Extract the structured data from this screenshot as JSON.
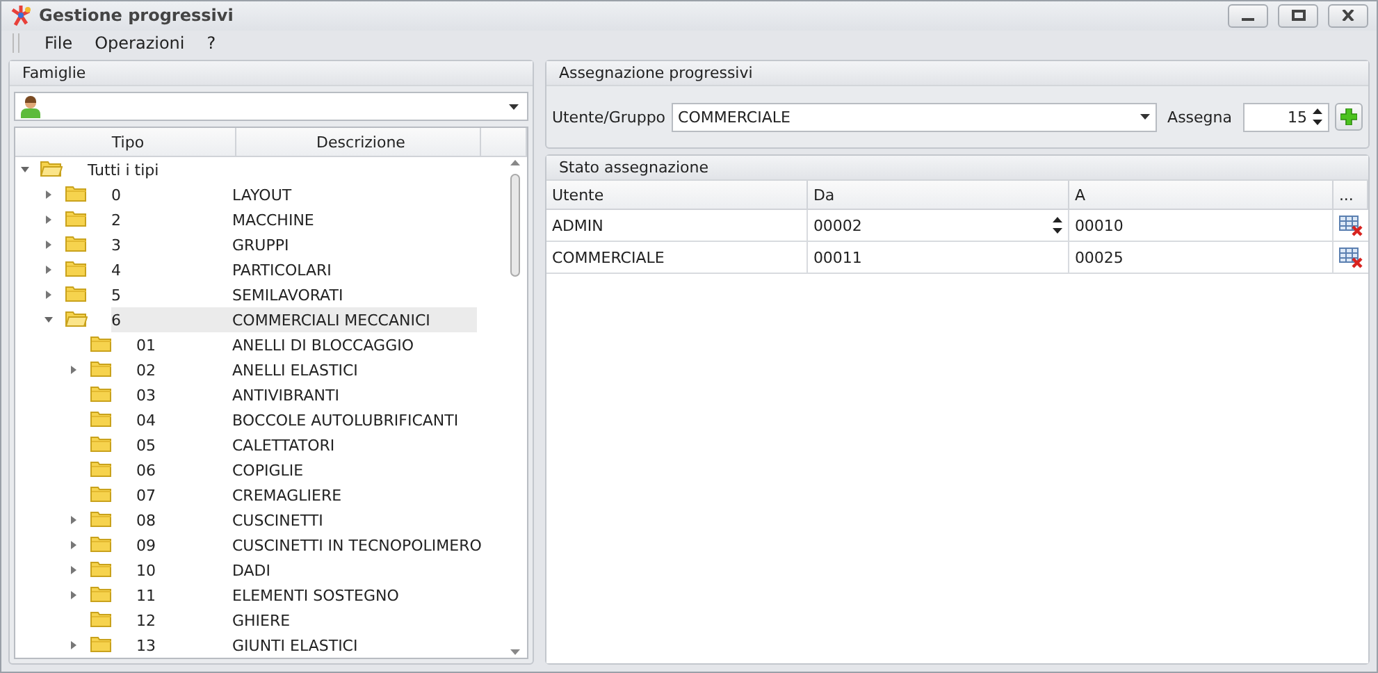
{
  "window": {
    "title": "Gestione progressivi"
  },
  "menu": [
    "File",
    "Operazioni",
    "?"
  ],
  "famiglie": {
    "title": "Famiglie",
    "columns": [
      "Tipo",
      "Descrizione"
    ],
    "tree": [
      {
        "tipo": "Tutti i tipi",
        "expandable": true,
        "expanded": true,
        "selected": false,
        "children": [
          {
            "tipo": "0",
            "descrizione": "LAYOUT",
            "expandable": true,
            "expanded": false,
            "selected": false
          },
          {
            "tipo": "2",
            "descrizione": "MACCHINE",
            "expandable": true,
            "expanded": false,
            "selected": false
          },
          {
            "tipo": "3",
            "descrizione": "GRUPPI",
            "expandable": true,
            "expanded": false,
            "selected": false
          },
          {
            "tipo": "4",
            "descrizione": "PARTICOLARI",
            "expandable": true,
            "expanded": false,
            "selected": false
          },
          {
            "tipo": "5",
            "descrizione": "SEMILAVORATI",
            "expandable": true,
            "expanded": false,
            "selected": false
          },
          {
            "tipo": "6",
            "descrizione": "COMMERCIALI MECCANICI",
            "expandable": true,
            "expanded": true,
            "selected": true,
            "children": [
              {
                "tipo": "01",
                "descrizione": "ANELLI DI BLOCCAGGIO",
                "expandable": false,
                "expanded": false,
                "selected": false
              },
              {
                "tipo": "02",
                "descrizione": "ANELLI ELASTICI",
                "expandable": true,
                "expanded": false,
                "selected": false
              },
              {
                "tipo": "03",
                "descrizione": "ANTIVIBRANTI",
                "expandable": false,
                "expanded": false,
                "selected": false
              },
              {
                "tipo": "04",
                "descrizione": "BOCCOLE AUTOLUBRIFICANTI",
                "expandable": false,
                "expanded": false,
                "selected": false
              },
              {
                "tipo": "05",
                "descrizione": "CALETTATORI",
                "expandable": false,
                "expanded": false,
                "selected": false
              },
              {
                "tipo": "06",
                "descrizione": "COPIGLIE",
                "expandable": false,
                "expanded": false,
                "selected": false
              },
              {
                "tipo": "07",
                "descrizione": "CREMAGLIERE",
                "expandable": false,
                "expanded": false,
                "selected": false
              },
              {
                "tipo": "08",
                "descrizione": "CUSCINETTI",
                "expandable": true,
                "expanded": false,
                "selected": false
              },
              {
                "tipo": "09",
                "descrizione": "CUSCINETTI IN TECNOPOLIMERO",
                "expandable": true,
                "expanded": false,
                "selected": false
              },
              {
                "tipo": "10",
                "descrizione": "DADI",
                "expandable": true,
                "expanded": false,
                "selected": false
              },
              {
                "tipo": "11",
                "descrizione": "ELEMENTI SOSTEGNO",
                "expandable": true,
                "expanded": false,
                "selected": false
              },
              {
                "tipo": "12",
                "descrizione": "GHIERE",
                "expandable": false,
                "expanded": false,
                "selected": false
              },
              {
                "tipo": "13",
                "descrizione": "GIUNTI ELASTICI",
                "expandable": true,
                "expanded": false,
                "selected": false
              }
            ]
          }
        ]
      }
    ]
  },
  "assegnazione": {
    "title": "Assegnazione progressivi",
    "user_label": "Utente/Gruppo",
    "user_value": "COMMERCIALE",
    "assign_label": "Assegna",
    "assign_value": "15"
  },
  "stato": {
    "title": "Stato assegnazione",
    "columns": [
      "Utente",
      "Da",
      "A",
      "..."
    ],
    "rows": [
      {
        "utente": "ADMIN",
        "da": "00002",
        "a": "00010",
        "editing": true
      },
      {
        "utente": "COMMERCIALE",
        "da": "00011",
        "a": "00025",
        "editing": false
      }
    ]
  }
}
